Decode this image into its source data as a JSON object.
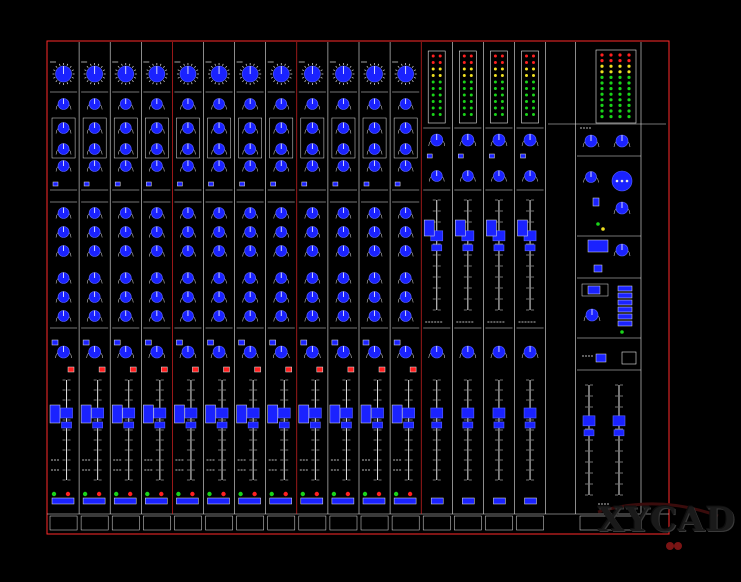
{
  "drawing": {
    "background": "#000000",
    "frame_color": "#ff2a2a",
    "line_color": "#e8e8e8",
    "knob_color": "#1a22ff",
    "meter_colors": {
      "low": "#19d419",
      "mid": "#f0e020",
      "high": "#ff2020"
    }
  },
  "mixer": {
    "mono_channels": 12,
    "stereo_channels": 4,
    "master_sections": 2
  },
  "watermark": {
    "text": "XYCAD",
    "logo_name": "xycad-logo"
  }
}
